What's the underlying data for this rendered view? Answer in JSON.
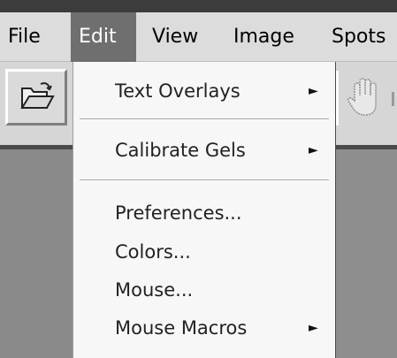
{
  "menubar": {
    "items": [
      {
        "label": "File",
        "active": false
      },
      {
        "label": "Edit",
        "active": true
      },
      {
        "label": "View",
        "active": false
      },
      {
        "label": "Image",
        "active": false
      },
      {
        "label": "Spots",
        "active": false
      }
    ]
  },
  "toolbar": {
    "buttons": [
      {
        "icon": "open-folder-icon"
      },
      {
        "icon": "hand-icon"
      }
    ]
  },
  "edit_menu": {
    "items": [
      {
        "label": "Text Overlays",
        "submenu": true
      },
      {
        "label": "Calibrate Gels",
        "submenu": true
      },
      {
        "label": "Preferences...",
        "submenu": false
      },
      {
        "label": "Colors...",
        "submenu": false
      },
      {
        "label": "Mouse...",
        "submenu": false
      },
      {
        "label": "Mouse Macros",
        "submenu": true
      }
    ],
    "submenu_arrow": "►"
  },
  "colors": {
    "menubar_bg": "#dcdcdc",
    "active_menu_bg": "#6f6f6f",
    "dropdown_bg": "#f7f7f7",
    "workspace_bg": "#8a8a8a"
  }
}
